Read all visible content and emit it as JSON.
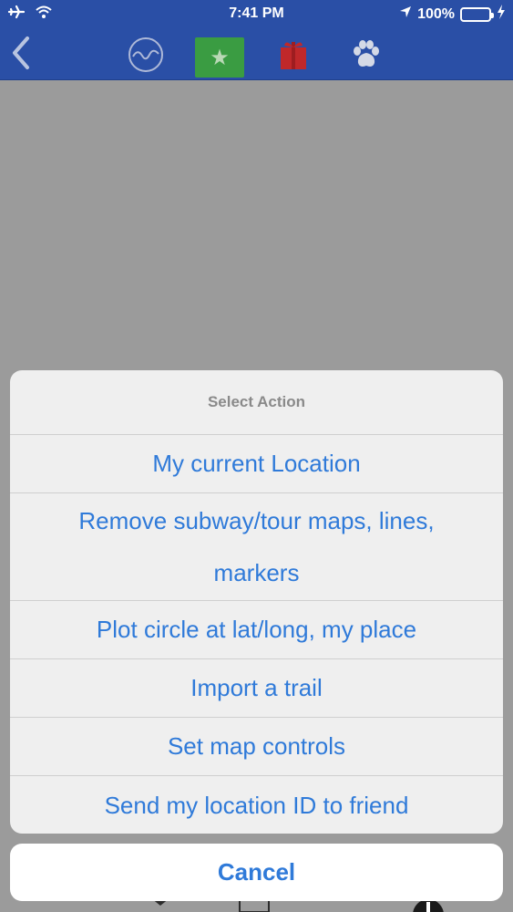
{
  "status_bar": {
    "time": "7:41 PM",
    "battery_percent": "100%",
    "battery_level": 1.0
  },
  "nav": {
    "tabs": [
      {
        "icon": "wave-circle-icon"
      },
      {
        "icon": "star-icon",
        "selected": true
      },
      {
        "icon": "gift-icon"
      },
      {
        "icon": "paw-icon"
      }
    ]
  },
  "action_sheet": {
    "title": "Select Action",
    "actions": [
      "My current Location",
      "Remove subway/tour maps, lines, markers",
      "Plot circle at lat/long, my place",
      "Import a trail",
      "Set map controls",
      "Send my location ID to friend"
    ],
    "cancel_label": "Cancel"
  },
  "colors": {
    "nav_blue": "#2a4fa6",
    "action_blue": "#2f7ad9",
    "selected_tab_green": "#3a9c42",
    "gift_red": "#c0282a",
    "battery_green": "#4cd964"
  }
}
